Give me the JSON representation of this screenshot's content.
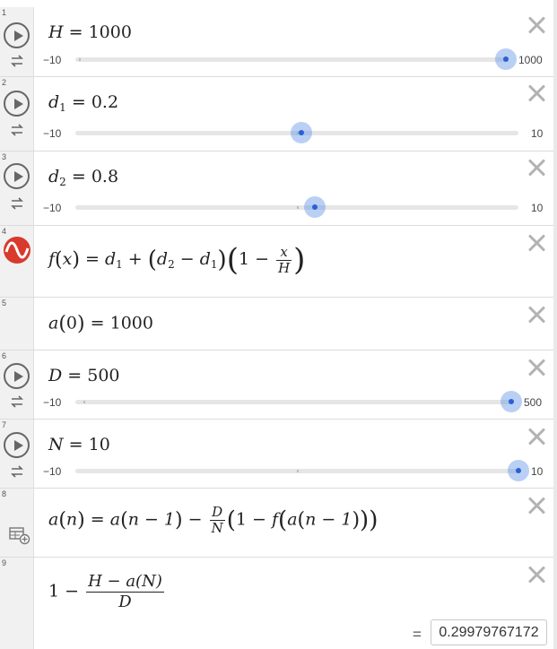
{
  "rows": [
    {
      "num": "1",
      "expr": {
        "var": "H",
        "value": "1000"
      },
      "slider": {
        "min": "−10",
        "max": "1000",
        "value_fraction": 1.0
      }
    },
    {
      "num": "2",
      "expr": {
        "var": "d",
        "sub": "1",
        "value": "0.2"
      },
      "slider": {
        "min": "−10",
        "max": "10",
        "value_fraction": 0.51
      }
    },
    {
      "num": "3",
      "expr": {
        "var": "d",
        "sub": "2",
        "value": "0.8"
      },
      "slider": {
        "min": "−10",
        "max": "10",
        "value_fraction": 0.54
      }
    },
    {
      "num": "4",
      "function": {
        "lhs_name": "f",
        "lhs_arg": "x",
        "d1": "d",
        "d1_sub": "1",
        "d2": "d",
        "d2_sub": "2",
        "one": "1",
        "frac_num": "x",
        "frac_den": "H"
      }
    },
    {
      "num": "5",
      "expr": {
        "lhs": "a",
        "arg": "0",
        "value": "1000"
      }
    },
    {
      "num": "6",
      "expr": {
        "var": "D",
        "value": "500"
      },
      "slider": {
        "min": "−10",
        "max": "500",
        "value_fraction": 1.0
      }
    },
    {
      "num": "7",
      "expr": {
        "var": "N",
        "value": "10"
      },
      "slider": {
        "min": "−10",
        "max": "10",
        "value_fraction": 1.0
      }
    },
    {
      "num": "8",
      "recursion": {
        "lhs": "a",
        "arg": "n",
        "prev": "n − 1",
        "frac_num": "D",
        "frac_den": "N",
        "one": "1",
        "f": "f"
      }
    },
    {
      "num": "9",
      "result_expr": {
        "one": "1",
        "frac_num": "H − a(N)",
        "frac_den": "D"
      },
      "result": {
        "equals": "=",
        "value": "0.29979767172"
      }
    }
  ],
  "colors": {
    "accent": "#2a5fd6",
    "thumb_halo": "#94b4ee",
    "function_icon": "#d83a2e",
    "gutter": "#f1f1f1"
  },
  "icons": [
    "play-icon",
    "repeat-icon",
    "close-icon",
    "function-icon",
    "table-icon"
  ]
}
